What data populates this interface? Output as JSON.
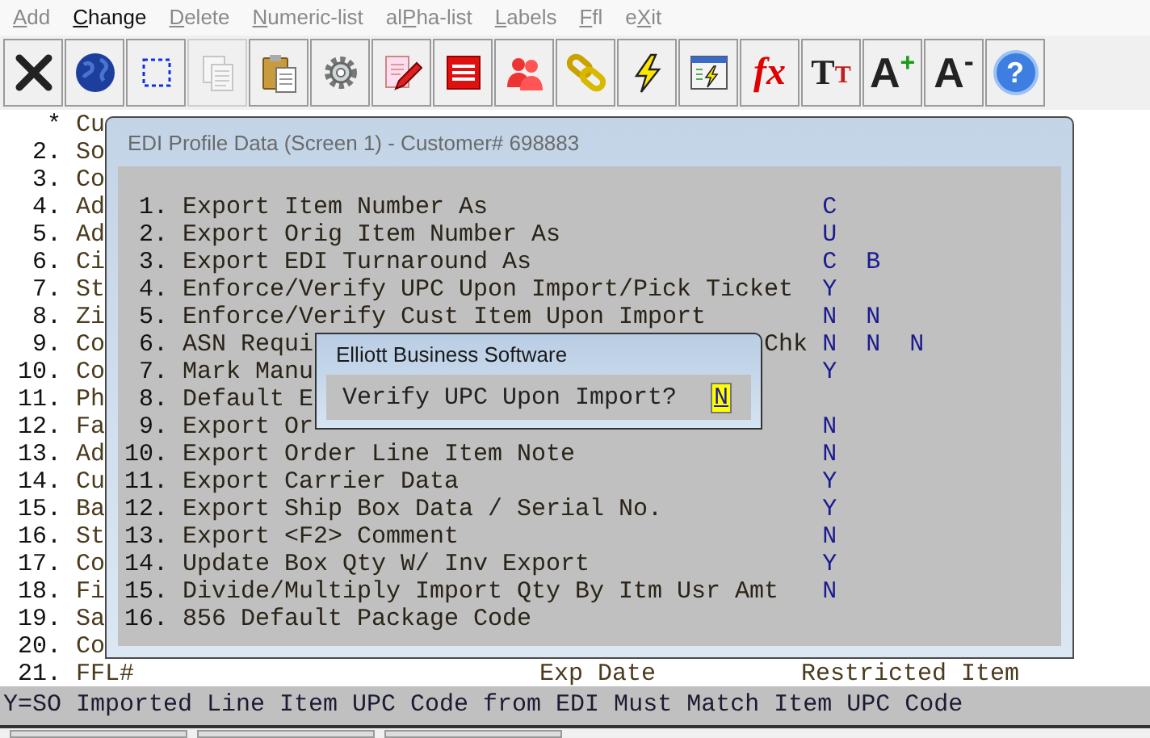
{
  "menu": [
    {
      "key": "A",
      "after": "dd",
      "disabled": true
    },
    {
      "key": "C",
      "after": "hange",
      "disabled": false
    },
    {
      "key": "D",
      "after": "elete",
      "disabled": true
    },
    {
      "key": "N",
      "after": "umeric-list",
      "disabled": true
    },
    {
      "before": "al",
      "key": "P",
      "after": "ha-list",
      "disabled": true
    },
    {
      "key": "L",
      "after": "abels",
      "disabled": true
    },
    {
      "key": "F",
      "after": "fl",
      "disabled": true
    },
    {
      "before": "e",
      "key": "X",
      "after": "it",
      "disabled": true
    }
  ],
  "toolbar": [
    {
      "kind": "icon",
      "disabled": false
    },
    {
      "kind": "icon",
      "disabled": false
    },
    {
      "kind": "icon",
      "disabled": false
    },
    {
      "kind": "icon",
      "disabled": true
    },
    {
      "kind": "icon",
      "disabled": false
    },
    {
      "kind": "icon",
      "disabled": false
    },
    {
      "kind": "icon",
      "disabled": false
    },
    {
      "kind": "icon",
      "disabled": false
    },
    {
      "kind": "icon",
      "disabled": false
    },
    {
      "kind": "icon",
      "disabled": false
    },
    {
      "kind": "icon",
      "disabled": false
    },
    {
      "kind": "icon",
      "disabled": false
    },
    {
      "kind": "glyph",
      "glyph": "fx",
      "disabled": false
    },
    {
      "kind": "glyph",
      "glyph": "T",
      "badge": "T",
      "disabled": false
    },
    {
      "kind": "glyph",
      "glyph": "A",
      "badge": "+",
      "disabled": false
    },
    {
      "kind": "glyph",
      "glyph": "A",
      "badge": "-",
      "disabled": false
    },
    {
      "kind": "help",
      "glyph": "?",
      "disabled": false
    }
  ],
  "screen_rows": [
    {
      "number": "*",
      "label": "Cu"
    },
    {
      "number": "2.",
      "label": "So"
    },
    {
      "number": "3.",
      "label": "Co"
    },
    {
      "number": "4.",
      "label": "Ad"
    },
    {
      "number": "5.",
      "label": "Ad"
    },
    {
      "number": "6.",
      "label": "Ci"
    },
    {
      "number": "7.",
      "label": "St"
    },
    {
      "number": "8.",
      "label": "Zi"
    },
    {
      "number": "9.",
      "label": "Co"
    },
    {
      "number": "10.",
      "label": "Co"
    },
    {
      "number": "11.",
      "label": "Ph"
    },
    {
      "number": "12.",
      "label": "Fa"
    },
    {
      "number": "13.",
      "label": "Ad"
    },
    {
      "number": "14.",
      "label": "Cu"
    },
    {
      "number": "15.",
      "label": "Ba"
    },
    {
      "number": "16.",
      "label": "St"
    },
    {
      "number": "17.",
      "label": "Co"
    },
    {
      "number": "18.",
      "label": "Fi"
    },
    {
      "number": "19.",
      "label": "Sa"
    },
    {
      "number": "20.",
      "label": "Co"
    },
    {
      "number": "21.",
      "label": "FFL#",
      "fields": [
        "Exp Date",
        "Restricted Item"
      ]
    }
  ],
  "edi_window": {
    "title": "EDI Profile Data (Screen 1) - Customer# 698883",
    "rows": [
      {
        "number": "1.",
        "label": "Export Item Number As",
        "values": [
          "C"
        ]
      },
      {
        "number": "2.",
        "label": "Export Orig Item Number As",
        "values": [
          "U"
        ]
      },
      {
        "number": "3.",
        "label": "Export EDI Turnaround As",
        "values": [
          "C",
          "B"
        ]
      },
      {
        "number": "4.",
        "label": "Enforce/Verify UPC Upon Import/Pick Ticket",
        "values": [
          "Y"
        ]
      },
      {
        "number": "5.",
        "label": "Enforce/Verify Cust Item Upon Import",
        "values": [
          "N",
          "N"
        ]
      },
      {
        "number": "6.",
        "label": "ASN Requi",
        "label_tail": "Chk",
        "values": [
          "N",
          "N",
          "N"
        ]
      },
      {
        "number": "7.",
        "label": "Mark Manu",
        "values": [
          "Y"
        ]
      },
      {
        "number": "8.",
        "label": "Default E"
      },
      {
        "number": "9.",
        "label": "Export Or",
        "values": [
          "N"
        ]
      },
      {
        "number": "10.",
        "label": "Export Order Line Item Note",
        "values": [
          "N"
        ]
      },
      {
        "number": "11.",
        "label": "Export Carrier Data",
        "values": [
          "Y"
        ]
      },
      {
        "number": "12.",
        "label": "Export Ship Box Data / Serial No.",
        "values": [
          "Y"
        ]
      },
      {
        "number": "13.",
        "label": "Export <F2> Comment",
        "values": [
          "N"
        ]
      },
      {
        "number": "14.",
        "label": "Update Box Qty W/ Inv Export",
        "values": [
          "Y"
        ]
      },
      {
        "number": "15.",
        "label": "Divide/Multiply Import Qty By Itm Usr Amt",
        "values": [
          "N"
        ]
      },
      {
        "number": "16.",
        "label": "856 Default Package Code"
      }
    ]
  },
  "dialog": {
    "title": "Elliott Business Software",
    "prompt": "Verify UPC Upon Import?",
    "answer": "N"
  },
  "status_bar": {
    "text": "Y=SO Imported Line Item UPC Code from EDI Must Match Item UPC Code"
  }
}
